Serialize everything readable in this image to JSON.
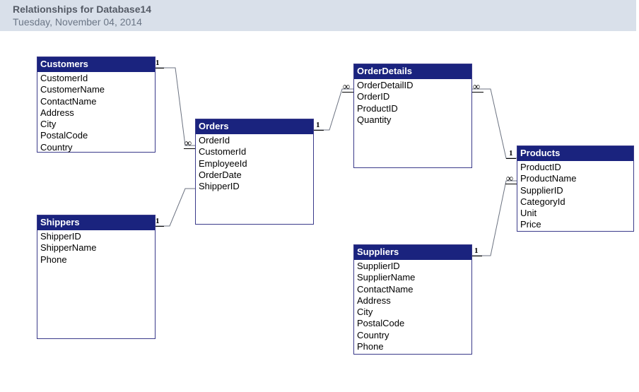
{
  "header": {
    "title": "Relationships for Database14",
    "date": "Tuesday, November 04, 2014"
  },
  "tables": {
    "customers": {
      "title": "Customers",
      "fields": [
        "CustomerId",
        "CustomerName",
        "ContactName",
        "Address",
        "City",
        "PostalCode",
        "Country"
      ]
    },
    "orders": {
      "title": "Orders",
      "fields": [
        "OrderId",
        "CustomerId",
        "EmployeeId",
        "OrderDate",
        "ShipperID"
      ]
    },
    "orderdetails": {
      "title": "OrderDetails",
      "fields": [
        "OrderDetailID",
        "OrderID",
        "ProductID",
        "Quantity"
      ]
    },
    "products": {
      "title": "Products",
      "fields": [
        "ProductID",
        "ProductName",
        "SupplierID",
        "CategoryId",
        "Unit",
        "Price"
      ]
    },
    "shippers": {
      "title": "Shippers",
      "fields": [
        "ShipperID",
        "ShipperName",
        "Phone"
      ]
    },
    "suppliers": {
      "title": "Suppliers",
      "fields": [
        "SupplierID",
        "SupplierName",
        "ContactName",
        "Address",
        "City",
        "PostalCode",
        "Country",
        "Phone"
      ]
    }
  },
  "relationships": [
    {
      "from": "Customers.CustomerId",
      "to": "Orders.CustomerId",
      "fromCard": "1",
      "toCard": "∞"
    },
    {
      "from": "Shippers.ShipperID",
      "to": "Orders.ShipperID",
      "fromCard": "1",
      "toCard": "∞"
    },
    {
      "from": "Orders.OrderId",
      "to": "OrderDetails.OrderID",
      "fromCard": "1",
      "toCard": "∞"
    },
    {
      "from": "OrderDetails.ProductID",
      "to": "Products.ProductID",
      "fromCard": "∞",
      "toCard": "1"
    },
    {
      "from": "Suppliers.SupplierID",
      "to": "Products.SupplierID",
      "fromCard": "1",
      "toCard": "∞"
    }
  ],
  "symbols": {
    "one": "1",
    "many": "∞"
  }
}
